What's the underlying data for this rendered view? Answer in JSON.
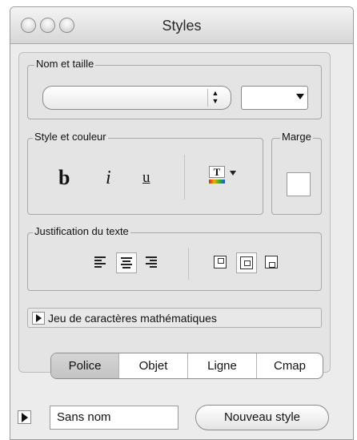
{
  "window": {
    "title": "Styles"
  },
  "groups": {
    "name_size": "Nom et taille",
    "style_color": "Style et couleur",
    "margin": "Marge",
    "justification": "Justification du texte"
  },
  "style_buttons": {
    "bold": "b",
    "italic": "i",
    "underline": "u",
    "text_color": "T"
  },
  "math_charset": {
    "label": "Jeu de caractères mathématiques"
  },
  "tabs": [
    "Police",
    "Objet",
    "Ligne",
    "Cmap"
  ],
  "active_tab": "Police",
  "footer": {
    "style_name": "Sans nom",
    "new_style_button": "Nouveau style"
  }
}
